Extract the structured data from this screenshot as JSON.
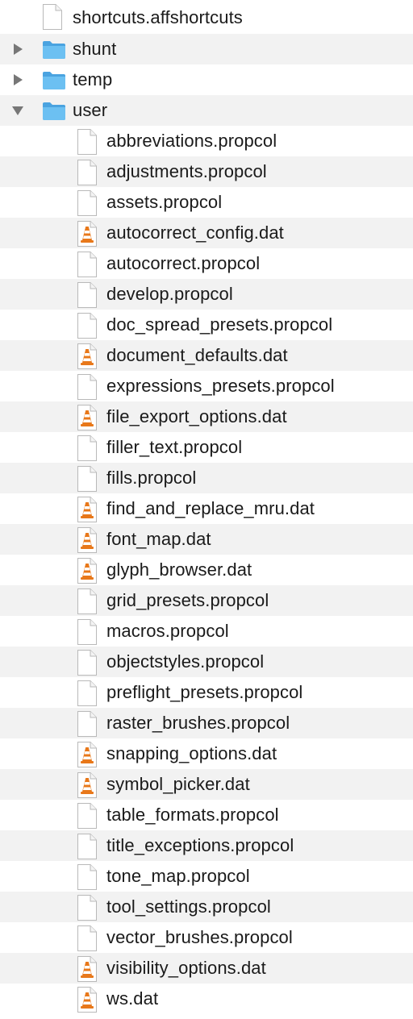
{
  "colors": {
    "stripe": "#f2f2f2",
    "folder_blue": "#5fb5ec",
    "folder_tab": "#4aa3e0",
    "vlc_orange": "#e8781a",
    "text": "#1a1a1a",
    "disclosure": "#777777"
  },
  "list": {
    "top_item": {
      "name": "shortcuts.affshortcuts",
      "icon": "document-icon"
    },
    "folders": [
      {
        "name": "shunt",
        "expanded": false,
        "icon": "folder-icon"
      },
      {
        "name": "temp",
        "expanded": false,
        "icon": "folder-icon"
      },
      {
        "name": "user",
        "expanded": true,
        "icon": "folder-icon"
      }
    ],
    "user_files": [
      {
        "name": "abbreviations.propcol",
        "icon": "document-icon"
      },
      {
        "name": "adjustments.propcol",
        "icon": "document-icon"
      },
      {
        "name": "assets.propcol",
        "icon": "document-icon"
      },
      {
        "name": "autocorrect_config.dat",
        "icon": "vlc-cone-icon"
      },
      {
        "name": "autocorrect.propcol",
        "icon": "document-icon"
      },
      {
        "name": "develop.propcol",
        "icon": "document-icon"
      },
      {
        "name": "doc_spread_presets.propcol",
        "icon": "document-icon"
      },
      {
        "name": "document_defaults.dat",
        "icon": "vlc-cone-icon"
      },
      {
        "name": "expressions_presets.propcol",
        "icon": "document-icon"
      },
      {
        "name": "file_export_options.dat",
        "icon": "vlc-cone-icon"
      },
      {
        "name": "filler_text.propcol",
        "icon": "document-icon"
      },
      {
        "name": "fills.propcol",
        "icon": "document-icon"
      },
      {
        "name": "find_and_replace_mru.dat",
        "icon": "vlc-cone-icon"
      },
      {
        "name": "font_map.dat",
        "icon": "vlc-cone-icon"
      },
      {
        "name": "glyph_browser.dat",
        "icon": "vlc-cone-icon"
      },
      {
        "name": "grid_presets.propcol",
        "icon": "document-icon"
      },
      {
        "name": "macros.propcol",
        "icon": "document-icon"
      },
      {
        "name": "objectstyles.propcol",
        "icon": "document-icon"
      },
      {
        "name": "preflight_presets.propcol",
        "icon": "document-icon"
      },
      {
        "name": "raster_brushes.propcol",
        "icon": "document-icon"
      },
      {
        "name": "snapping_options.dat",
        "icon": "vlc-cone-icon"
      },
      {
        "name": "symbol_picker.dat",
        "icon": "vlc-cone-icon"
      },
      {
        "name": "table_formats.propcol",
        "icon": "document-icon"
      },
      {
        "name": "title_exceptions.propcol",
        "icon": "document-icon"
      },
      {
        "name": "tone_map.propcol",
        "icon": "document-icon"
      },
      {
        "name": "tool_settings.propcol",
        "icon": "document-icon"
      },
      {
        "name": "vector_brushes.propcol",
        "icon": "document-icon"
      },
      {
        "name": "visibility_options.dat",
        "icon": "vlc-cone-icon"
      },
      {
        "name": "ws.dat",
        "icon": "vlc-cone-icon"
      }
    ]
  }
}
